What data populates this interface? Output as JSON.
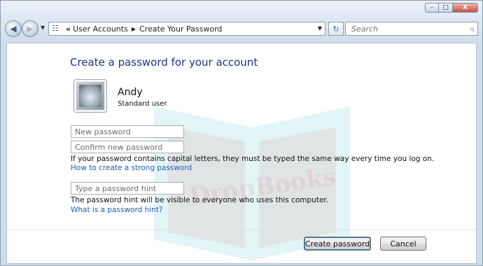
{
  "titlebar": {
    "minimize": "–",
    "maximize": "□",
    "close": "X"
  },
  "nav": {
    "back_glyph": "◀",
    "forward_glyph": "▶",
    "dropdown_glyph": "▼",
    "icons": {
      "back": "back-arrow-icon",
      "forward": "forward-arrow-icon",
      "location": "user-accounts-icon",
      "refresh": "refresh-icon",
      "search": "search-icon"
    }
  },
  "address": {
    "icon_glyph": "☷",
    "chevron": "«",
    "breadcrumbs": [
      "User Accounts",
      "Create Your Password"
    ],
    "separator": "▶",
    "dropdown_glyph": "▼"
  },
  "refresh_glyph": "↻",
  "search": {
    "placeholder": "Search",
    "icon_glyph": "⌕"
  },
  "main": {
    "heading": "Create a password for your account",
    "user": {
      "name": "Andy",
      "type": "Standard user"
    },
    "fields": {
      "new_password": {
        "placeholder": "New password",
        "value": ""
      },
      "confirm_password": {
        "placeholder": "Confirm new password",
        "value": ""
      },
      "hint": {
        "placeholder": "Type a password hint",
        "value": ""
      }
    },
    "capital_note": "If your password contains capital letters, they must be typed the same way every time you log on.",
    "strong_link": "How to create a strong password",
    "hint_note": "The password hint will be visible to everyone who uses this computer.",
    "hint_link": "What is a password hint?"
  },
  "buttons": {
    "create": "Create password",
    "cancel": "Cancel"
  },
  "watermark_text": "DropBooks",
  "colors": {
    "heading": "#1e3287",
    "link": "#1a5fb4",
    "frame": "#d8e4f0"
  }
}
